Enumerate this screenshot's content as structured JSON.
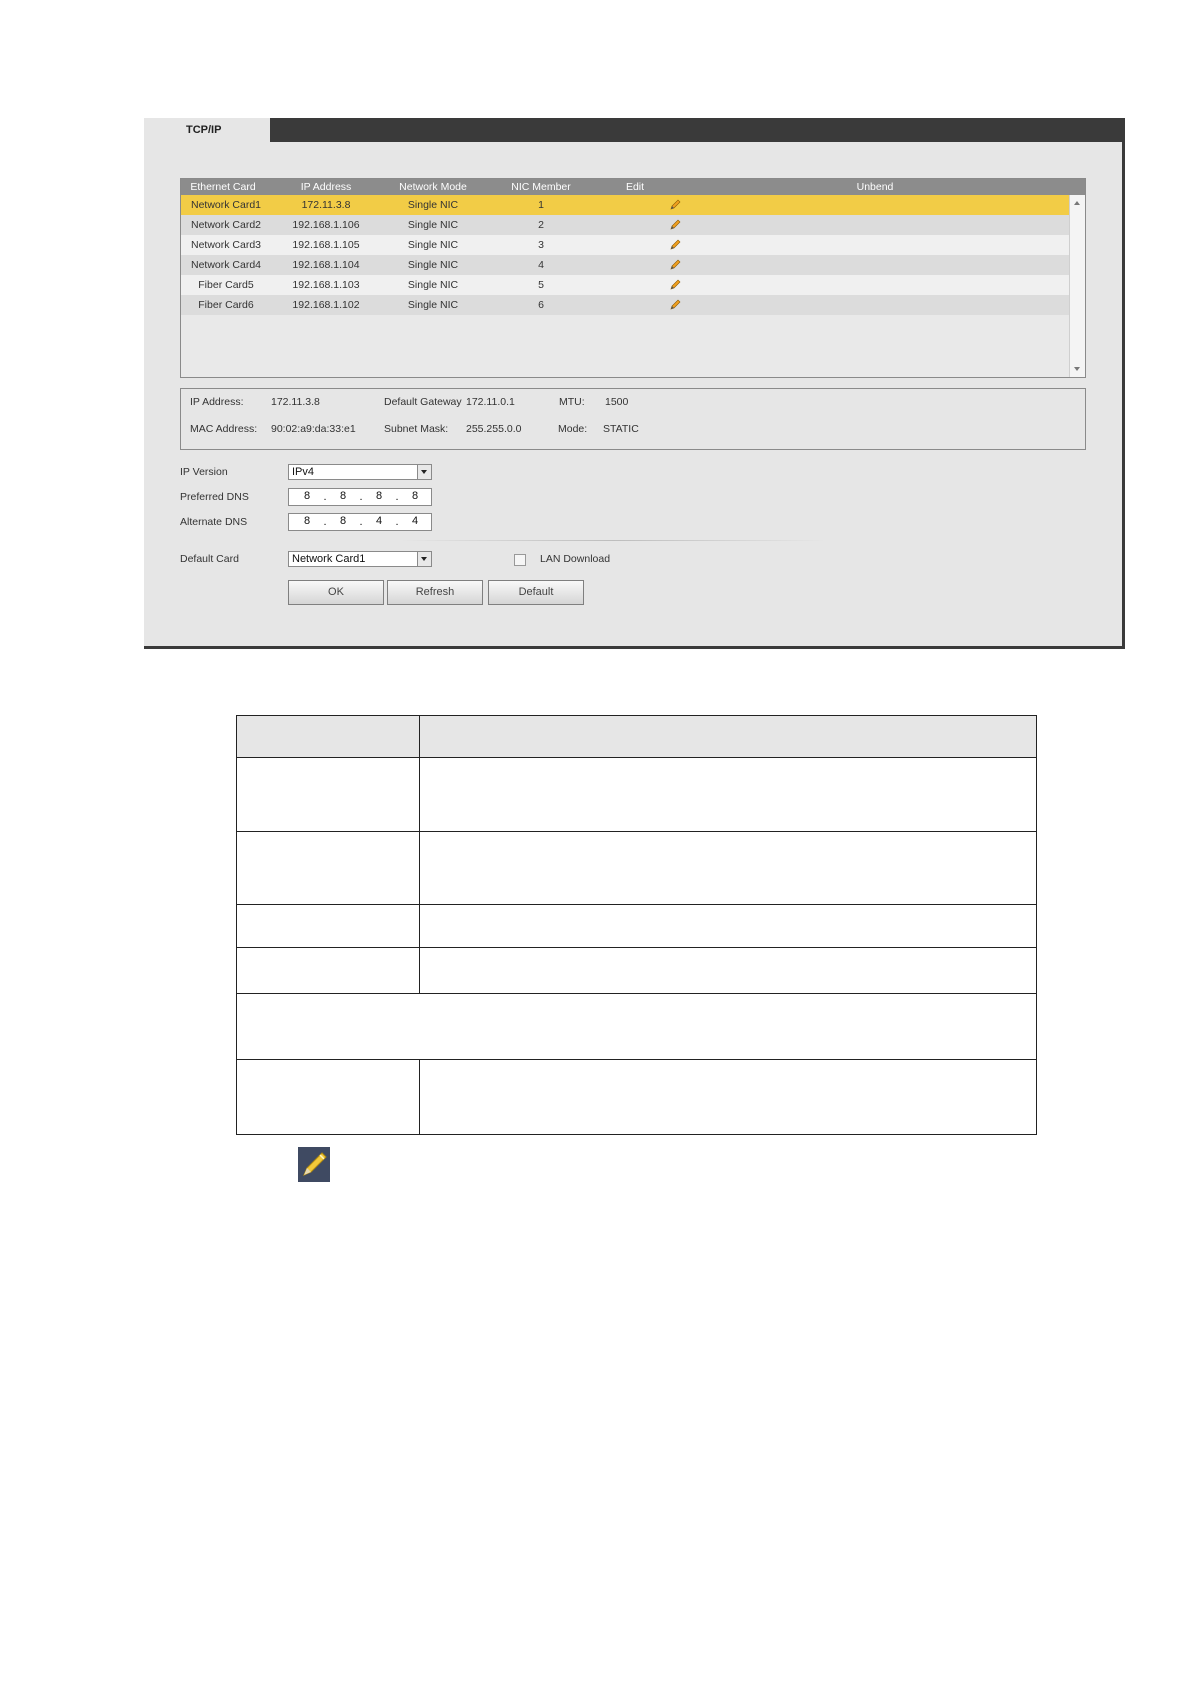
{
  "tab": {
    "title": "TCP/IP"
  },
  "card_table": {
    "headers": [
      "Ethernet Card",
      "IP Address",
      "Network Mode",
      "NIC Member",
      "Edit",
      "Unbend"
    ],
    "rows": [
      {
        "card": "Network Card1",
        "ip": "172.11.3.8",
        "mode": "Single NIC",
        "member": "1",
        "selected": true
      },
      {
        "card": "Network Card2",
        "ip": "192.168.1.106",
        "mode": "Single NIC",
        "member": "2"
      },
      {
        "card": "Network Card3",
        "ip": "192.168.1.105",
        "mode": "Single NIC",
        "member": "3"
      },
      {
        "card": "Network Card4",
        "ip": "192.168.1.104",
        "mode": "Single NIC",
        "member": "4"
      },
      {
        "card": "Fiber Card5",
        "ip": "192.168.1.103",
        "mode": "Single NIC",
        "member": "5"
      },
      {
        "card": "Fiber Card6",
        "ip": "192.168.1.102",
        "mode": "Single NIC",
        "member": "6"
      }
    ],
    "edit_icon": "pencil-icon"
  },
  "info": {
    "ip_label": "IP Address:",
    "ip_value": "172.11.3.8",
    "gateway_label": "Default Gateway",
    "gateway_value": "172.11.0.1",
    "mtu_label": "MTU:",
    "mtu_value": "1500",
    "mac_label": "MAC Address:",
    "mac_value": "90:02:a9:da:33:e1",
    "mask_label": "Subnet Mask:",
    "mask_value": "255.255.0.0",
    "mode_label": "Mode:",
    "mode_value": "STATIC"
  },
  "form": {
    "ip_version_label": "IP Version",
    "ip_version_value": "IPv4",
    "preferred_dns_label": "Preferred DNS",
    "preferred_dns": [
      "8",
      "8",
      "8",
      "8"
    ],
    "alternate_dns_label": "Alternate DNS",
    "alternate_dns": [
      "8",
      "8",
      "4",
      "4"
    ],
    "default_card_label": "Default Card",
    "default_card_value": "Network Card1",
    "lan_download_label": "LAN Download",
    "lan_download_checked": false
  },
  "buttons": {
    "ok": "OK",
    "refresh": "Refresh",
    "default": "Default"
  },
  "colors": {
    "selected_row": "#f2cc46",
    "header_bg": "#8c8c8c",
    "title_bar": "#3a3a3a",
    "panel_bg": "#e6e6e6"
  },
  "note_icon": "pencil-icon"
}
